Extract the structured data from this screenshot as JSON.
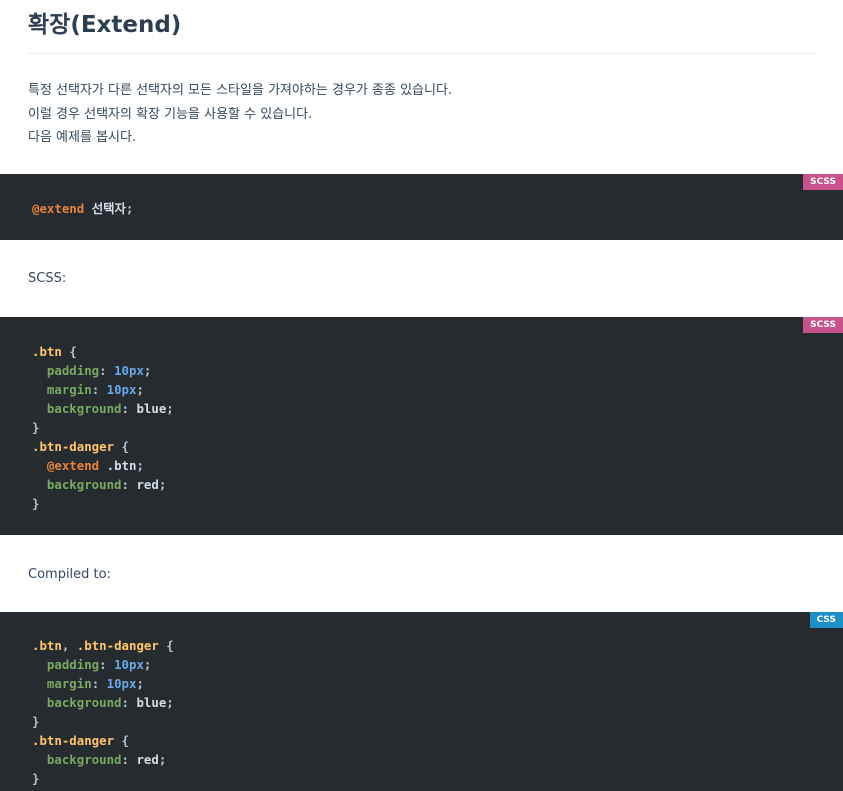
{
  "page": {
    "title": "확장(Extend)",
    "intro": [
      "특정 선택자가 다른 선택자의 모든 스타일을 가져야하는 경우가 종종 있습니다.",
      "이럴 경우 선택자의 확장 기능을 사용할 수 있습니다.",
      "다음 예제를 봅시다."
    ],
    "label_scss": "SCSS:",
    "label_compiled": "Compiled to:"
  },
  "blocks": [
    {
      "lang": "scss",
      "lines": [
        "@extend 선택자;"
      ]
    },
    {
      "lang": "scss",
      "lines": [
        ".btn {",
        "  padding: 10px;",
        "  margin: 10px;",
        "  background: blue;",
        "}",
        ".btn-danger {",
        "  @extend .btn;",
        "  background: red;",
        "}"
      ]
    },
    {
      "lang": "css",
      "lines": [
        ".btn, .btn-danger {",
        "  padding: 10px;",
        "  margin: 10px;",
        "  background: blue;",
        "}",
        ".btn-danger {",
        "  background: red;",
        "}"
      ]
    }
  ],
  "colors": {
    "code_bg": "#262b30",
    "scss_badge": "#c6538c",
    "css_badge": "#1e8fc7",
    "at_rule": "#e8833a",
    "selector": "#ffc66d",
    "property": "#79a862",
    "number": "#6aa8e8"
  }
}
